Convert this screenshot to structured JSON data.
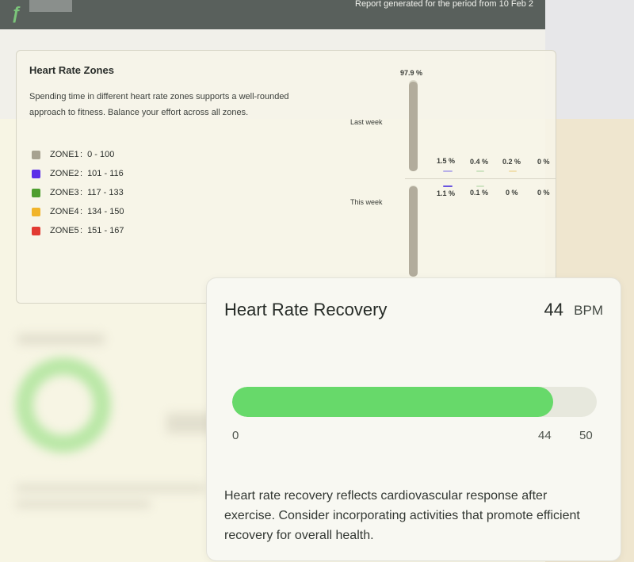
{
  "header": {
    "logo_glyph": "ƒ",
    "report_text": "Report generated for the period from 10 Feb 2"
  },
  "zones": {
    "title": "Heart Rate Zones",
    "description": "Spending time in different heart rate zones supports a well-rounded approach to fitness. Balance your effort across all zones.",
    "legend": [
      {
        "label": "ZONE1",
        "range": "0 - 100",
        "color": "#a7a290"
      },
      {
        "label": "ZONE2",
        "range": "101 - 116",
        "color": "#5b2ee8"
      },
      {
        "label": "ZONE3",
        "range": "117 - 133",
        "color": "#4e9e2f"
      },
      {
        "label": "ZONE4",
        "range": "134 - 150",
        "color": "#f1b42a"
      },
      {
        "label": "ZONE5",
        "range": "151 - 167",
        "color": "#e23a32"
      }
    ],
    "weeks": [
      {
        "label": "Last week",
        "zone1_pct": "97.9 %",
        "zone1_fraction": 0.979,
        "others": [
          "1.5 %",
          "0.4 %",
          "0.2 %",
          "0 %"
        ]
      },
      {
        "label": "This week",
        "zone1_fraction": 0.989,
        "others": [
          "1.1 %",
          "0.1 %",
          "0 %",
          "0 %"
        ]
      }
    ]
  },
  "recovery": {
    "title": "Heart Rate Recovery",
    "value": "44",
    "unit": "BPM",
    "min": "0",
    "current": "44",
    "max": "50",
    "fill_fraction": 0.88,
    "fill_color": "#67d96a",
    "description": "Heart rate recovery reflects cardiovascular response after exercise. Consider incorporating activities that promote efficient recovery for overall health."
  }
}
